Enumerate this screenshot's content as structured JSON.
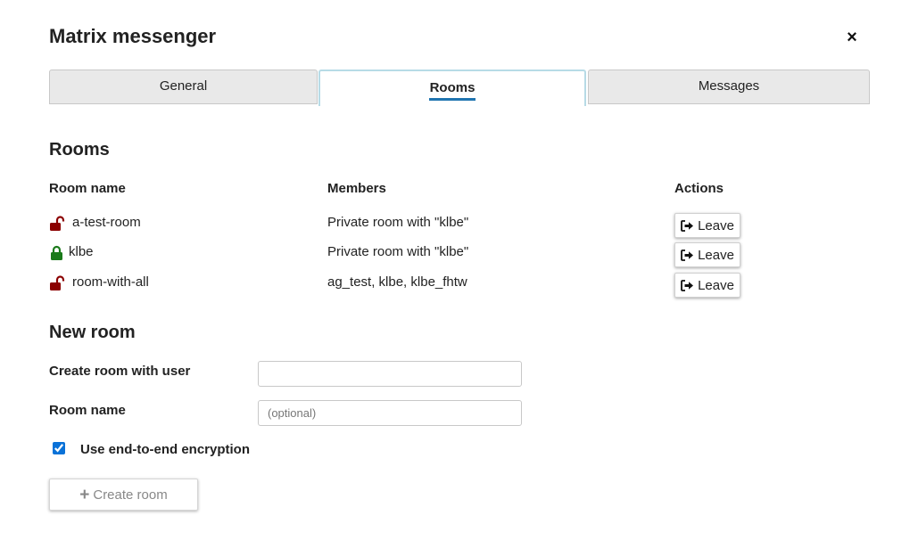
{
  "dialog": {
    "title": "Matrix messenger",
    "close_label": "×"
  },
  "tabs": [
    {
      "label": "General",
      "active": false
    },
    {
      "label": "Rooms",
      "active": true
    },
    {
      "label": "Messages",
      "active": false
    }
  ],
  "rooms_section": {
    "heading": "Rooms",
    "columns": {
      "name": "Room name",
      "members": "Members",
      "actions": "Actions"
    },
    "rows": [
      {
        "name": "a-test-room",
        "members": "Private room with \"klbe\"",
        "encrypted": false,
        "action": "Leave"
      },
      {
        "name": "klbe",
        "members": "Private room with \"klbe\"",
        "encrypted": true,
        "action": "Leave"
      },
      {
        "name": "room-with-all",
        "members": "ag_test, klbe, klbe_fhtw",
        "encrypted": false,
        "action": "Leave"
      }
    ]
  },
  "new_room": {
    "heading": "New room",
    "user_label": "Create room with user",
    "user_value": "",
    "name_label": "Room name",
    "name_placeholder": "(optional)",
    "encryption_label": "Use end-to-end encryption",
    "encryption_checked": true,
    "create_label": "Create room"
  },
  "colors": {
    "lock_open": "#8b0000",
    "lock_closed": "#1a7a1a",
    "active_tab_underline": "#1f74b0",
    "active_tab_border": "#b7dbe6"
  }
}
